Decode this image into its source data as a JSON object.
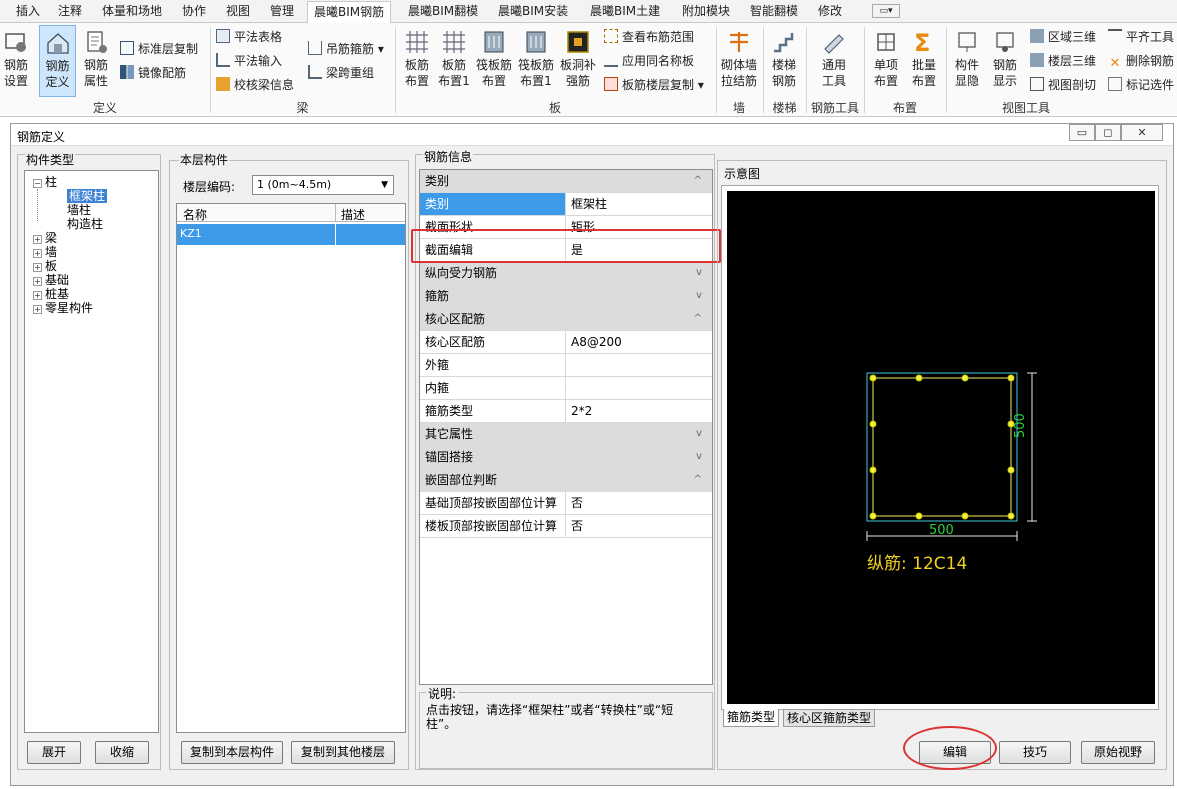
{
  "menubar": {
    "items": [
      "插入",
      "注释",
      "体量和场地",
      "协作",
      "视图",
      "管理",
      "晨曦BIM钢筋",
      "晨曦BIM翻模",
      "晨曦BIM安装",
      "晨曦BIM土建",
      "附加模块",
      "智能翻模",
      "修改"
    ],
    "active_index": 6
  },
  "ribbon": {
    "def_group": {
      "label": "定义",
      "b1": [
        "钢筋",
        "设置"
      ],
      "b2": [
        "钢筋",
        "定义"
      ],
      "b3": [
        "钢筋",
        "属性"
      ],
      "s1": "标准层复制",
      "s2": "镜像配筋"
    },
    "beam_group": {
      "label": "梁",
      "s1": "平法表格",
      "s2": "平法输入",
      "s3": "校核梁信息",
      "s4": "吊筋箍筋",
      "s5": "梁跨重组"
    },
    "slab_group": {
      "label": "板",
      "b1": [
        "板筋",
        "布置"
      ],
      "b2": [
        "板筋",
        "布置1"
      ],
      "b3": [
        "筏板筋",
        "布置"
      ],
      "b4": [
        "筏板筋",
        "布置1"
      ],
      "b5": [
        "板洞补",
        "强筋"
      ],
      "s1": "查看布筋范围",
      "s2": "应用同名称板",
      "s3": "板筋楼层复制"
    },
    "wall_group": {
      "label": "墙",
      "b1": [
        "砌体墙",
        "拉结筋"
      ]
    },
    "stair_group": {
      "label": "楼梯",
      "b1": [
        "楼梯",
        "钢筋"
      ]
    },
    "tool_group": {
      "label": "钢筋工具",
      "b1": [
        "通用",
        "工具"
      ]
    },
    "layout_group": {
      "label": "布置",
      "b1": [
        "单项",
        "布置"
      ],
      "b2": [
        "批量",
        "布置"
      ]
    },
    "view_group": {
      "label": "视图工具",
      "b1": [
        "构件",
        "显隐"
      ],
      "b2": [
        "钢筋",
        "显示"
      ],
      "s1": "区域三维",
      "s2": "楼层三维",
      "s3": "视图剖切",
      "s4": "平齐工具",
      "s5": "删除钢筋",
      "s6": "标记选件"
    }
  },
  "dialog": {
    "title": "钢筋定义",
    "component_types": {
      "label": "构件类型",
      "tree": [
        {
          "label": "柱",
          "children": [
            "框架柱",
            "墙柱",
            "构造柱"
          ]
        },
        {
          "label": "梁"
        },
        {
          "label": "墙"
        },
        {
          "label": "板"
        },
        {
          "label": "基础"
        },
        {
          "label": "桩基"
        },
        {
          "label": "零星构件"
        }
      ],
      "selected": "框架柱",
      "expand_btn": "展开",
      "collapse_btn": "收缩"
    },
    "layer": {
      "label": "本层构件",
      "floor_code_label": "楼层编码:",
      "floor_code_value": "1 (0m~4.5m)",
      "col_name": "名称",
      "col_desc": "描述",
      "rows": [
        {
          "name": "KZ1",
          "desc": ""
        }
      ],
      "copy_here_btn": "复制到本层构件",
      "copy_other_btn": "复制到其他楼层"
    },
    "rebar_info": {
      "label": "钢筋信息",
      "rows": [
        {
          "type": "cat",
          "k": "类别",
          "chev": "^"
        },
        {
          "type": "sel",
          "k": "类别",
          "v": "框架柱"
        },
        {
          "type": "row",
          "k": "截面形状",
          "v": "矩形"
        },
        {
          "type": "row",
          "k": "截面编辑",
          "v": "是"
        },
        {
          "type": "cat",
          "k": "纵向受力钢筋",
          "chev": "v"
        },
        {
          "type": "cat",
          "k": "箍筋",
          "chev": "v"
        },
        {
          "type": "cat",
          "k": "核心区配筋",
          "chev": "^"
        },
        {
          "type": "row",
          "k": "核心区配筋",
          "v": "A8@200"
        },
        {
          "type": "row",
          "k": "外箍",
          "v": ""
        },
        {
          "type": "row",
          "k": "内箍",
          "v": ""
        },
        {
          "type": "row",
          "k": "箍筋类型",
          "v": "2*2"
        },
        {
          "type": "cat",
          "k": "其它属性",
          "chev": "v"
        },
        {
          "type": "cat",
          "k": "锚固搭接",
          "chev": "v"
        },
        {
          "type": "cat",
          "k": "嵌固部位判断",
          "chev": "^"
        },
        {
          "type": "row",
          "k": "基础顶部按嵌固部位计算",
          "v": "否"
        },
        {
          "type": "row",
          "k": "楼板顶部按嵌固部位计算",
          "v": "否"
        }
      ],
      "note_label": "说明:",
      "note_text": "点击按钮，请选择“框架柱”或者“转换柱”或“短柱”。"
    },
    "diagram": {
      "label": "示意图",
      "dim_w": "500",
      "dim_h": "500",
      "rebar_text": "纵筋: 12C14",
      "tab1": "箍筋类型",
      "tab2": "核心区箍筋类型",
      "edit_btn": "编辑",
      "tips_btn": "技巧",
      "reset_btn": "原始视野"
    }
  }
}
